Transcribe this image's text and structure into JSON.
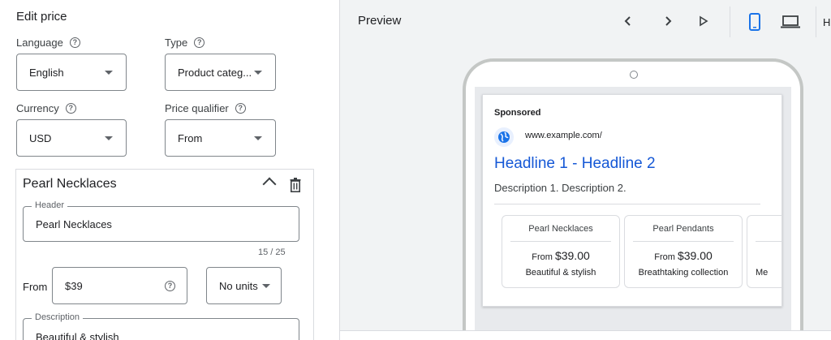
{
  "editor": {
    "title": "Edit price",
    "language": {
      "label": "Language",
      "value": "English"
    },
    "type": {
      "label": "Type",
      "value": "Product categ..."
    },
    "currency": {
      "label": "Currency",
      "value": "USD"
    },
    "qualifier": {
      "label": "Price qualifier",
      "value": "From"
    },
    "item": {
      "title": "Pearl Necklaces",
      "header_legend": "Header",
      "header_value": "Pearl Necklaces",
      "header_counter": "15 / 25",
      "from_label": "From",
      "price_value": "$39",
      "units_value": "No units",
      "description_legend": "Description",
      "description_value": "Beautiful & stylish"
    },
    "icons": {
      "help": "help-circle-icon",
      "collapse": "chevron-up-icon",
      "delete": "trash-icon"
    }
  },
  "preview": {
    "title": "Preview",
    "overflow_text": "Hi",
    "icons": [
      "chevron-left-icon",
      "chevron-right-icon",
      "play-icon",
      "mobile-icon",
      "desktop-icon"
    ],
    "accent_color": "#1a73e8",
    "ad": {
      "sponsored": "Sponsored",
      "url": "www.example.com/",
      "headline": "Headline 1 - Headline 2",
      "description": "Description 1. Description 2.",
      "sitelinks": [
        {
          "header": "Pearl Necklaces",
          "qualifier": "From",
          "price": "$39.00",
          "description": "Beautiful & stylish"
        },
        {
          "header": "Pearl Pendants",
          "qualifier": "From",
          "price": "$39.00",
          "description": "Breathtaking collection"
        },
        {
          "header": "",
          "qualifier": "",
          "price": "",
          "description": "Me"
        }
      ]
    }
  }
}
